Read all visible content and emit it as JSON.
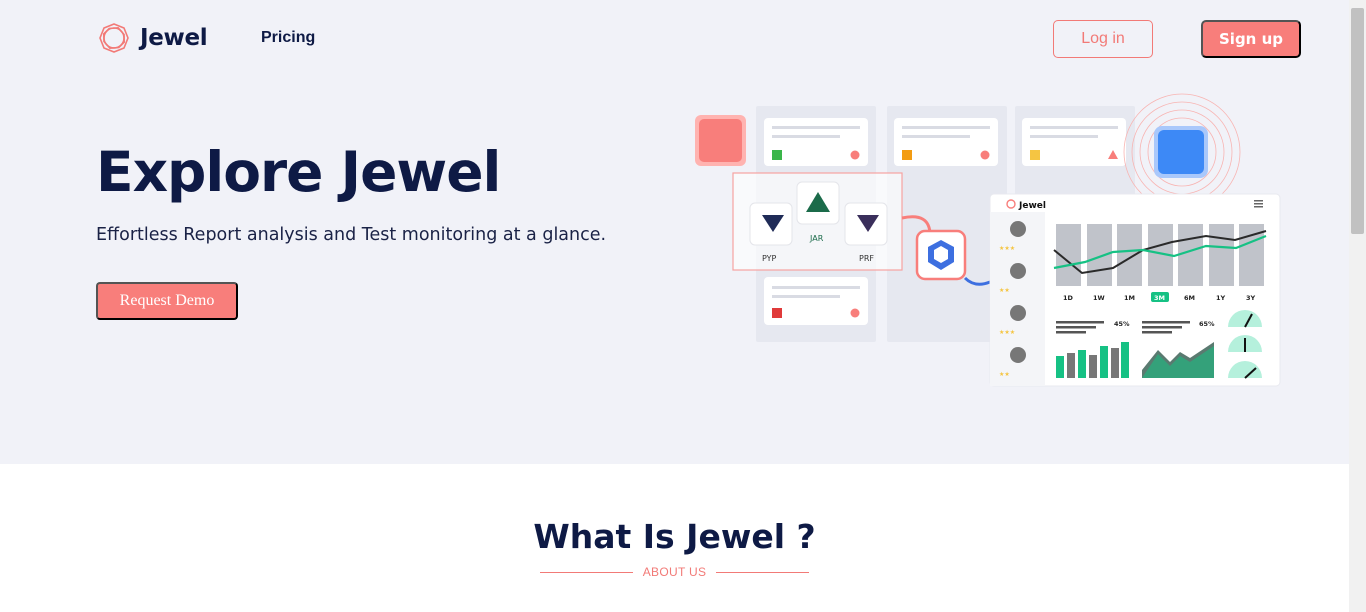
{
  "nav": {
    "brand": "Jewel",
    "pricing": "Pricing",
    "login": "Log in",
    "signup": "Sign up"
  },
  "hero": {
    "title": "Explore Jewel",
    "subtitle": "Effortless Report analysis and Test monitoring at a glance.",
    "cta": "Request Demo"
  },
  "illustration": {
    "dashboard_brand": "Jewel",
    "file_types": [
      "PYP",
      "JAR",
      "PRF"
    ],
    "periods": [
      "1D",
      "1W",
      "1M",
      "3M",
      "6M",
      "1Y",
      "3Y"
    ],
    "selected_period": "3M",
    "stat_1": "45%",
    "stat_2": "65%"
  },
  "about": {
    "title": "What Is Jewel ?",
    "eyebrow": "ABOUT US"
  },
  "colors": {
    "brand_coral": "#f87e7b",
    "navy": "#0e1a45",
    "hero_bg": "#f1f2f8",
    "accent_green": "#16c184",
    "accent_blue": "#3d89f6"
  }
}
